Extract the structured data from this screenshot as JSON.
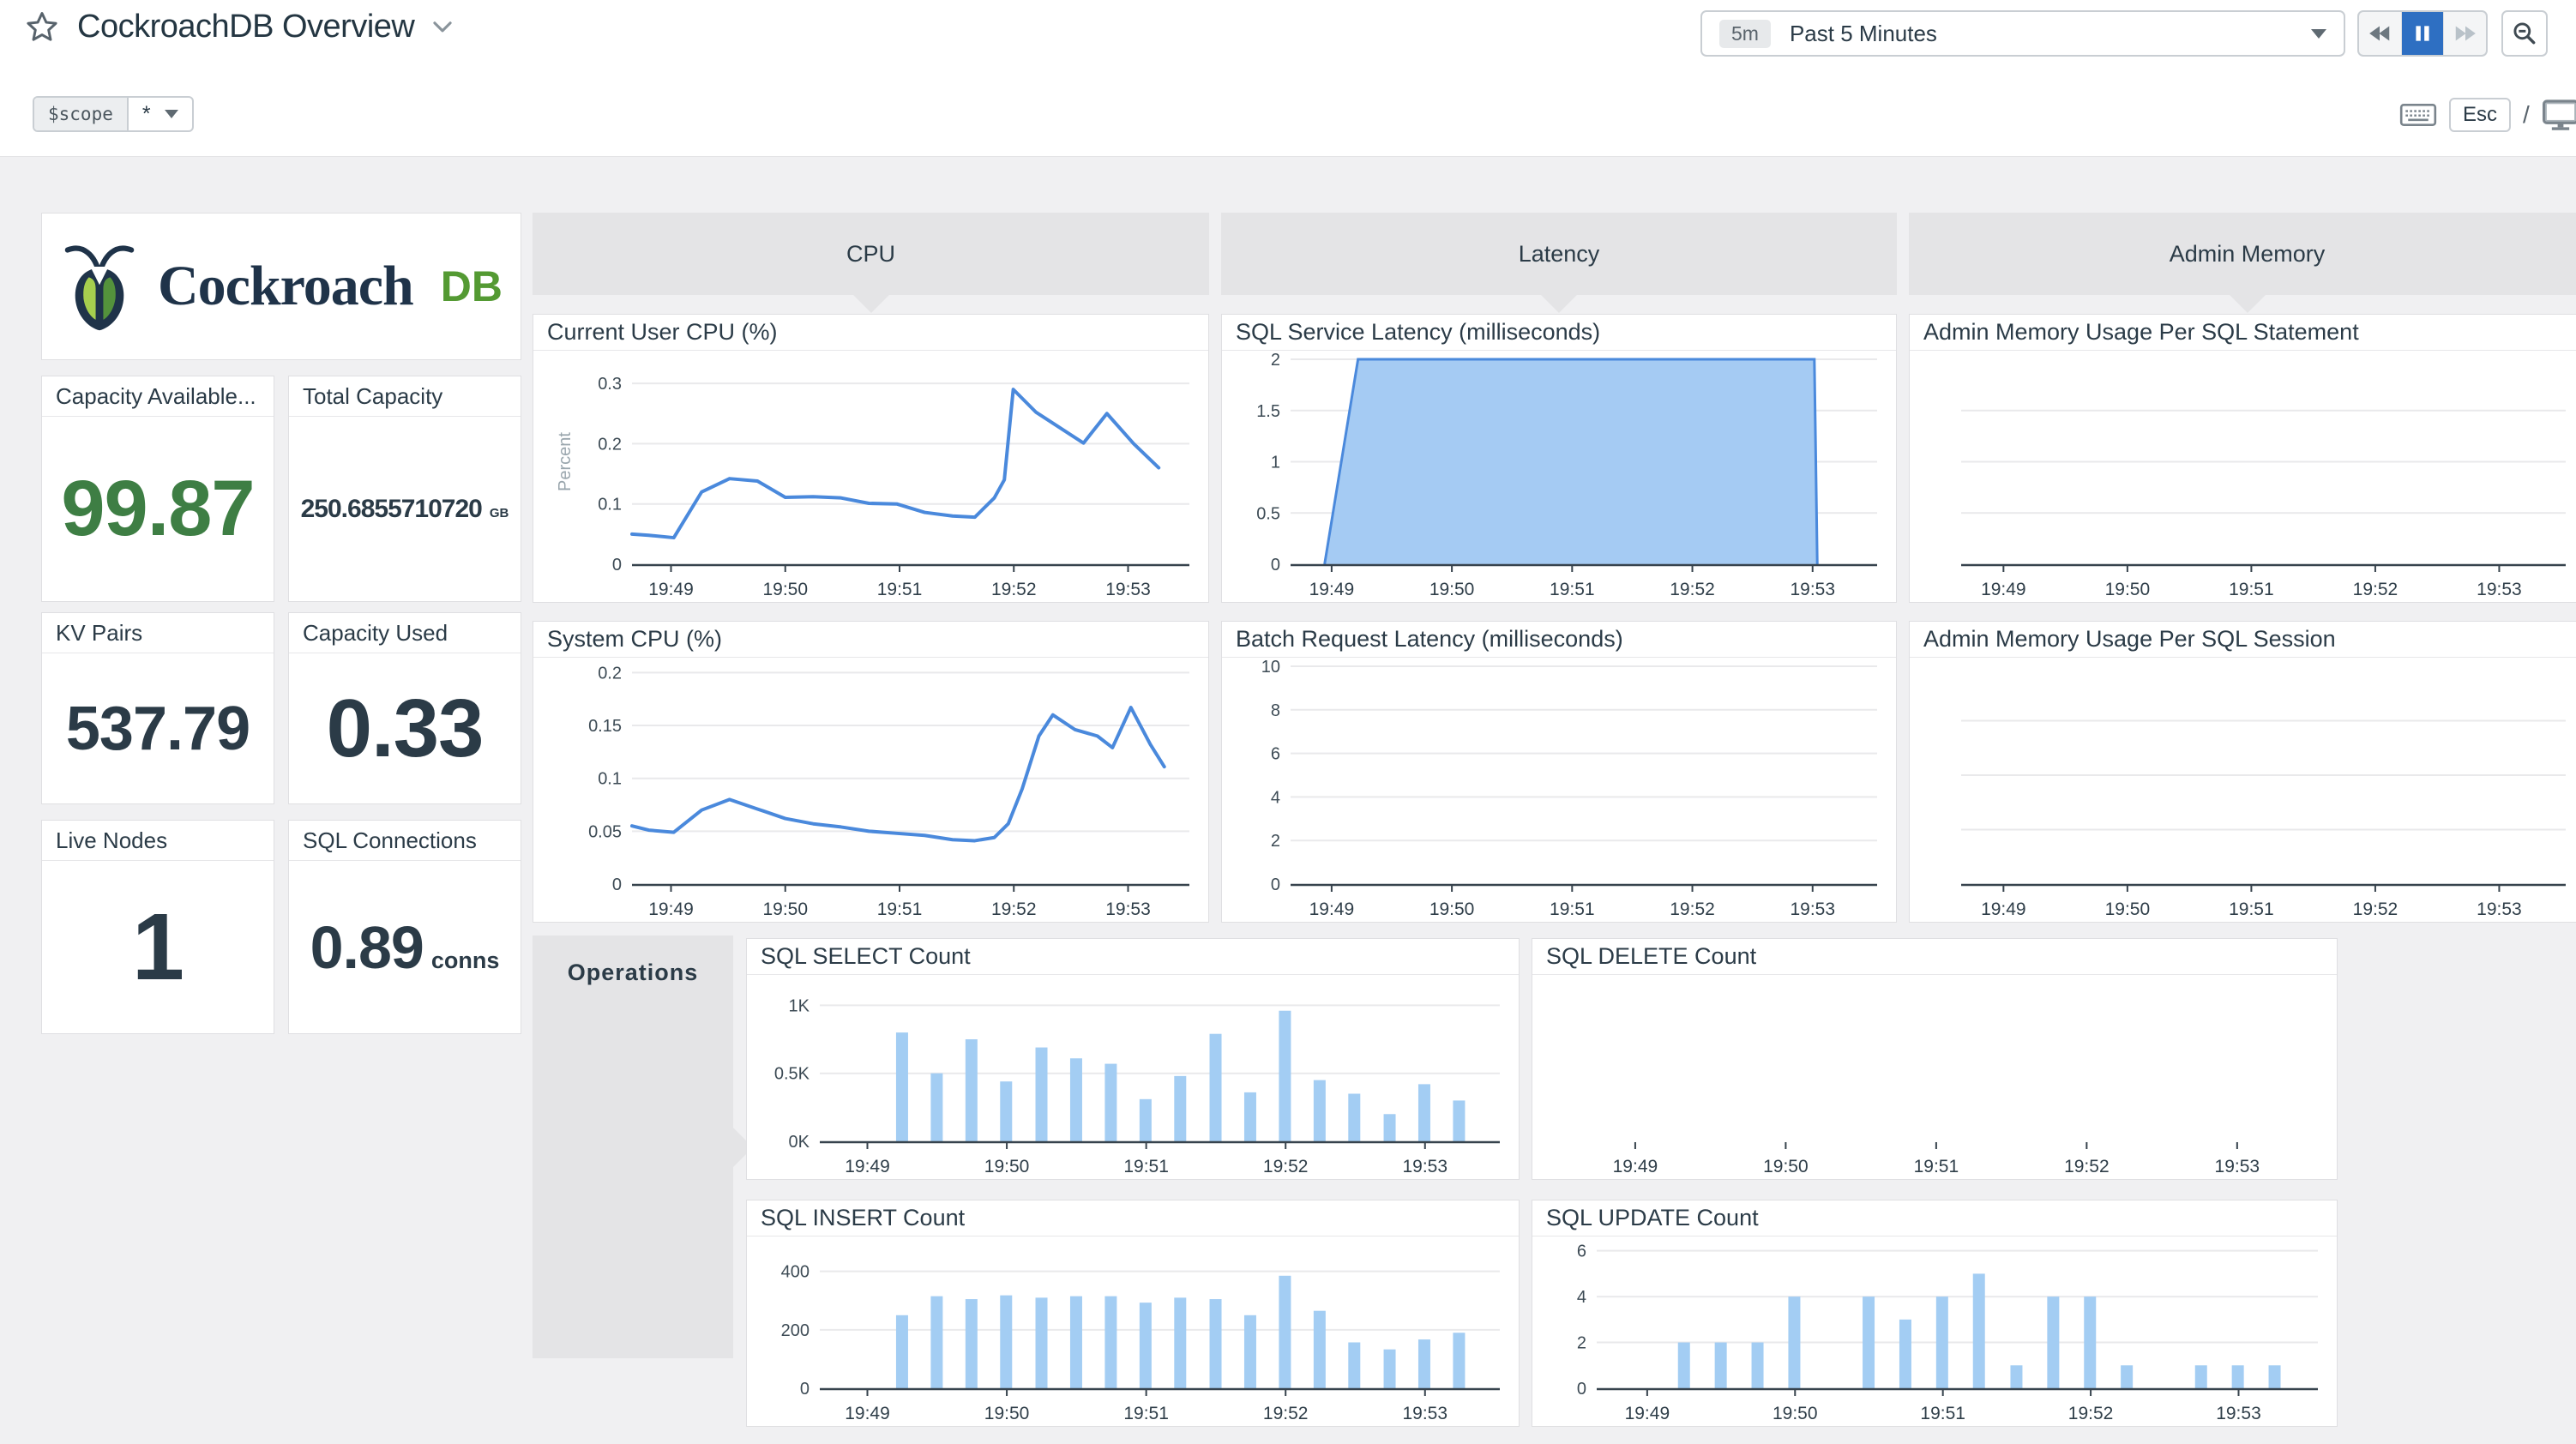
{
  "page": {
    "title": "CockroachDB Overview"
  },
  "toolbar": {
    "time_badge": "5m",
    "time_label": "Past 5 Minutes",
    "esc_label": "Esc",
    "slash": "/"
  },
  "scope": {
    "name": "$scope",
    "value": "*"
  },
  "logo": {
    "word": "Cockroach",
    "suffix": "DB"
  },
  "groups": {
    "cpu": "CPU",
    "latency": "Latency",
    "admin_memory": "Admin Memory",
    "operations": "Operations"
  },
  "stats": [
    {
      "label": "Capacity Available...",
      "value": "99.87",
      "unit": "",
      "color": "green"
    },
    {
      "label": "Total Capacity",
      "value": "250.6855710720",
      "unit": "GB",
      "color": "dark"
    },
    {
      "label": "KV Pairs",
      "value": "537.79",
      "unit": "",
      "color": "dark"
    },
    {
      "label": "Capacity Used",
      "value": "0.33",
      "unit": "",
      "color": "dark"
    },
    {
      "label": "Live Nodes",
      "value": "1",
      "unit": "",
      "color": "dark"
    },
    {
      "label": "SQL Connections",
      "value": "0.89",
      "unit": "conns",
      "color": "dark"
    }
  ],
  "colors": {
    "line_blue": "#4a89dc",
    "bar_blue": "#a3cdf3",
    "area_blue": "#a5cbf3",
    "stat_green": "#3e7e44",
    "group_header_gray": "#e4e4e6",
    "pause_active_blue": "#2e6fc2",
    "grid_gray": "#e9e9eb",
    "axis_dark": "#37434d"
  },
  "chart_data": [
    {
      "id": "current-user-cpu",
      "title": "Current User CPU (%)",
      "type": "line",
      "ylabel": "Percent",
      "ymax": 0.34,
      "gutter": 115,
      "yticks": [
        {
          "v": 0,
          "l": "0"
        },
        {
          "v": 0.1,
          "l": "0.1"
        },
        {
          "v": 0.2,
          "l": "0.2"
        },
        {
          "v": 0.3,
          "l": "0.3"
        }
      ],
      "x_ticks": [
        {
          "f": 0.07,
          "l": "19:49"
        },
        {
          "f": 0.275,
          "l": "19:50"
        },
        {
          "f": 0.48,
          "l": "19:51"
        },
        {
          "f": 0.685,
          "l": "19:52"
        },
        {
          "f": 0.89,
          "l": "19:53"
        }
      ],
      "points": [
        [
          0,
          0.05
        ],
        [
          0.03,
          0.048
        ],
        [
          0.075,
          0.044
        ],
        [
          0.125,
          0.12
        ],
        [
          0.175,
          0.142
        ],
        [
          0.225,
          0.138
        ],
        [
          0.275,
          0.111
        ],
        [
          0.325,
          0.112
        ],
        [
          0.375,
          0.11
        ],
        [
          0.425,
          0.101
        ],
        [
          0.475,
          0.1
        ],
        [
          0.525,
          0.086
        ],
        [
          0.575,
          0.08
        ],
        [
          0.615,
          0.078
        ],
        [
          0.65,
          0.11
        ],
        [
          0.668,
          0.14
        ],
        [
          0.684,
          0.29
        ],
        [
          0.725,
          0.252
        ],
        [
          0.77,
          0.225
        ],
        [
          0.81,
          0.201
        ],
        [
          0.852,
          0.25
        ],
        [
          0.9,
          0.2
        ],
        [
          0.945,
          0.16
        ]
      ]
    },
    {
      "id": "system-cpu",
      "title": "System CPU (%)",
      "type": "line",
      "ymax": 0.206,
      "gutter": 115,
      "yticks": [
        {
          "v": 0,
          "l": "0"
        },
        {
          "v": 0.05,
          "l": "0.05"
        },
        {
          "v": 0.1,
          "l": "0.1"
        },
        {
          "v": 0.15,
          "l": "0.15"
        },
        {
          "v": 0.2,
          "l": "0.2"
        }
      ],
      "x_ticks": [
        {
          "f": 0.07,
          "l": "19:49"
        },
        {
          "f": 0.275,
          "l": "19:50"
        },
        {
          "f": 0.48,
          "l": "19:51"
        },
        {
          "f": 0.685,
          "l": "19:52"
        },
        {
          "f": 0.89,
          "l": "19:53"
        }
      ],
      "points": [
        [
          0,
          0.055
        ],
        [
          0.03,
          0.051
        ],
        [
          0.075,
          0.049
        ],
        [
          0.125,
          0.07
        ],
        [
          0.175,
          0.08
        ],
        [
          0.225,
          0.071
        ],
        [
          0.275,
          0.062
        ],
        [
          0.325,
          0.057
        ],
        [
          0.375,
          0.054
        ],
        [
          0.425,
          0.05
        ],
        [
          0.475,
          0.048
        ],
        [
          0.525,
          0.046
        ],
        [
          0.575,
          0.042
        ],
        [
          0.615,
          0.041
        ],
        [
          0.65,
          0.044
        ],
        [
          0.675,
          0.057
        ],
        [
          0.7,
          0.09
        ],
        [
          0.73,
          0.14
        ],
        [
          0.755,
          0.16
        ],
        [
          0.795,
          0.146
        ],
        [
          0.835,
          0.14
        ],
        [
          0.862,
          0.129
        ],
        [
          0.895,
          0.167
        ],
        [
          0.93,
          0.132
        ],
        [
          0.955,
          0.111
        ]
      ]
    },
    {
      "id": "sql-service-latency",
      "title": "SQL Service Latency (milliseconds)",
      "type": "area",
      "ymax": 2,
      "gutter": 80,
      "yticks": [
        {
          "v": 0,
          "l": "0"
        },
        {
          "v": 0.5,
          "l": "0.5"
        },
        {
          "v": 1,
          "l": "1"
        },
        {
          "v": 1.5,
          "l": "1.5"
        },
        {
          "v": 2,
          "l": "2"
        }
      ],
      "x_ticks": [
        {
          "f": 0.07,
          "l": "19:49"
        },
        {
          "f": 0.275,
          "l": "19:50"
        },
        {
          "f": 0.48,
          "l": "19:51"
        },
        {
          "f": 0.685,
          "l": "19:52"
        },
        {
          "f": 0.89,
          "l": "19:53"
        }
      ],
      "points": [
        [
          0.058,
          0
        ],
        [
          0.115,
          2
        ],
        [
          0.893,
          2
        ],
        [
          0.898,
          0
        ]
      ]
    },
    {
      "id": "batch-request-latency",
      "title": "Batch Request Latency (milliseconds)",
      "type": "empty",
      "ymax": 10,
      "gutter": 80,
      "yticks": [
        {
          "v": 0,
          "l": "0"
        },
        {
          "v": 2,
          "l": "2"
        },
        {
          "v": 4,
          "l": "4"
        },
        {
          "v": 6,
          "l": "6"
        },
        {
          "v": 8,
          "l": "8"
        },
        {
          "v": 10,
          "l": "10"
        }
      ],
      "x_ticks": [
        {
          "f": 0.07,
          "l": "19:49"
        },
        {
          "f": 0.275,
          "l": "19:50"
        },
        {
          "f": 0.48,
          "l": "19:51"
        },
        {
          "f": 0.685,
          "l": "19:52"
        },
        {
          "f": 0.89,
          "l": "19:53"
        }
      ]
    },
    {
      "id": "admin-memory-statement",
      "title": "Admin Memory Usage Per SQL Statement",
      "type": "empty",
      "ymax": 1,
      "gutter": 60,
      "grid_unlabeled": 3,
      "yticks": [],
      "x_ticks": [
        {
          "f": 0.07,
          "l": "19:49"
        },
        {
          "f": 0.275,
          "l": "19:50"
        },
        {
          "f": 0.48,
          "l": "19:51"
        },
        {
          "f": 0.685,
          "l": "19:52"
        },
        {
          "f": 0.89,
          "l": "19:53"
        }
      ]
    },
    {
      "id": "admin-memory-session",
      "title": "Admin Memory Usage Per SQL Session",
      "type": "empty",
      "ymax": 1,
      "gutter": 60,
      "grid_unlabeled": 3,
      "yticks": [],
      "x_ticks": [
        {
          "f": 0.07,
          "l": "19:49"
        },
        {
          "f": 0.275,
          "l": "19:50"
        },
        {
          "f": 0.48,
          "l": "19:51"
        },
        {
          "f": 0.685,
          "l": "19:52"
        },
        {
          "f": 0.89,
          "l": "19:53"
        }
      ]
    },
    {
      "id": "sql-select-count",
      "title": "SQL SELECT Count",
      "type": "bar",
      "ymax": 1.16,
      "gutter": 85,
      "yticks": [
        {
          "v": 0,
          "l": "0K"
        },
        {
          "v": 0.5,
          "l": "0.5K"
        },
        {
          "v": 1,
          "l": "1K"
        }
      ],
      "x_ticks": [
        {
          "f": 0.07,
          "l": "19:49"
        },
        {
          "f": 0.275,
          "l": "19:50"
        },
        {
          "f": 0.48,
          "l": "19:51"
        },
        {
          "f": 0.685,
          "l": "19:52"
        },
        {
          "f": 0.89,
          "l": "19:53"
        }
      ],
      "bars": [
        [
          0.121,
          0.8
        ],
        [
          0.172,
          0.5
        ],
        [
          0.223,
          0.75
        ],
        [
          0.274,
          0.44
        ],
        [
          0.326,
          0.69
        ],
        [
          0.377,
          0.61
        ],
        [
          0.428,
          0.57
        ],
        [
          0.479,
          0.31
        ],
        [
          0.53,
          0.48
        ],
        [
          0.582,
          0.79
        ],
        [
          0.633,
          0.36
        ],
        [
          0.684,
          0.96
        ],
        [
          0.735,
          0.45
        ],
        [
          0.786,
          0.35
        ],
        [
          0.838,
          0.2
        ],
        [
          0.889,
          0.42
        ],
        [
          0.94,
          0.3
        ]
      ]
    },
    {
      "id": "sql-delete-count",
      "title": "SQL DELETE Count",
      "type": "empty",
      "ymax": 1,
      "gutter": 60,
      "axis": false,
      "yticks": [],
      "x_ticks": [
        {
          "f": 0.07,
          "l": "19:49"
        },
        {
          "f": 0.275,
          "l": "19:50"
        },
        {
          "f": 0.48,
          "l": "19:51"
        },
        {
          "f": 0.685,
          "l": "19:52"
        },
        {
          "f": 0.89,
          "l": "19:53"
        }
      ]
    },
    {
      "id": "sql-insert-count",
      "title": "SQL INSERT Count",
      "type": "bar",
      "ymax": 490,
      "gutter": 85,
      "yticks": [
        {
          "v": 0,
          "l": "0"
        },
        {
          "v": 200,
          "l": "200"
        },
        {
          "v": 400,
          "l": "400"
        }
      ],
      "x_ticks": [
        {
          "f": 0.07,
          "l": "19:49"
        },
        {
          "f": 0.275,
          "l": "19:50"
        },
        {
          "f": 0.48,
          "l": "19:51"
        },
        {
          "f": 0.685,
          "l": "19:52"
        },
        {
          "f": 0.89,
          "l": "19:53"
        }
      ],
      "bars": [
        [
          0.121,
          250
        ],
        [
          0.172,
          315
        ],
        [
          0.223,
          305
        ],
        [
          0.274,
          318
        ],
        [
          0.326,
          310
        ],
        [
          0.377,
          315
        ],
        [
          0.428,
          315
        ],
        [
          0.479,
          293
        ],
        [
          0.53,
          310
        ],
        [
          0.582,
          305
        ],
        [
          0.633,
          250
        ],
        [
          0.684,
          385
        ],
        [
          0.735,
          265
        ],
        [
          0.786,
          157
        ],
        [
          0.838,
          133
        ],
        [
          0.889,
          167
        ],
        [
          0.94,
          190
        ]
      ]
    },
    {
      "id": "sql-update-count",
      "title": "SQL UPDATE Count",
      "type": "bar",
      "ymax": 6.25,
      "gutter": 75,
      "yticks": [
        {
          "v": 0,
          "l": "0"
        },
        {
          "v": 2,
          "l": "2"
        },
        {
          "v": 4,
          "l": "4"
        },
        {
          "v": 6,
          "l": "6"
        }
      ],
      "x_ticks": [
        {
          "f": 0.07,
          "l": "19:49"
        },
        {
          "f": 0.275,
          "l": "19:50"
        },
        {
          "f": 0.48,
          "l": "19:51"
        },
        {
          "f": 0.685,
          "l": "19:52"
        },
        {
          "f": 0.89,
          "l": "19:53"
        }
      ],
      "bars": [
        [
          0.121,
          2
        ],
        [
          0.172,
          2
        ],
        [
          0.223,
          2
        ],
        [
          0.274,
          4
        ],
        [
          0.377,
          4
        ],
        [
          0.428,
          3
        ],
        [
          0.479,
          4
        ],
        [
          0.53,
          5
        ],
        [
          0.582,
          1
        ],
        [
          0.633,
          4
        ],
        [
          0.684,
          4
        ],
        [
          0.735,
          1
        ],
        [
          0.838,
          1
        ],
        [
          0.889,
          1
        ],
        [
          0.94,
          1
        ]
      ]
    }
  ]
}
